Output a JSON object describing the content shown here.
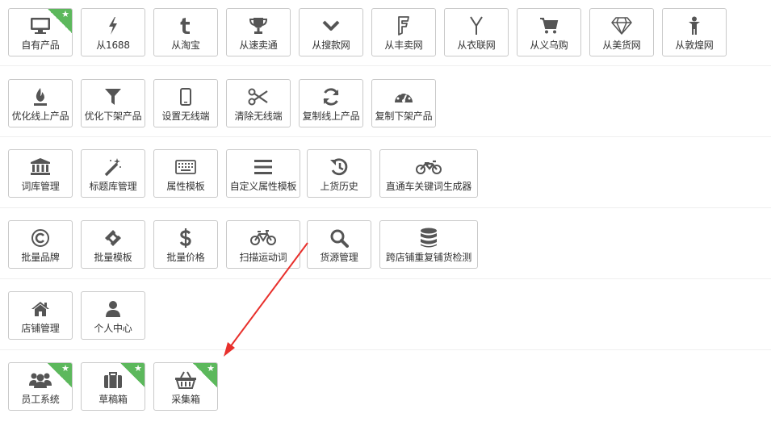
{
  "rows": [
    {
      "items": [
        {
          "label": "自有产品",
          "icon": "monitor-icon",
          "starred": true
        },
        {
          "label": "从1688",
          "icon": "lightning-icon",
          "starred": false
        },
        {
          "label": "从淘宝",
          "icon": "tumblr-t-icon",
          "starred": false
        },
        {
          "label": "从速卖通",
          "icon": "trophy-icon",
          "starred": false
        },
        {
          "label": "从搜款网",
          "icon": "chevron-down-icon",
          "starred": false
        },
        {
          "label": "从丰卖网",
          "icon": "foursquare-icon",
          "starred": false
        },
        {
          "label": "从衣联网",
          "icon": "y-letter-icon",
          "starred": false
        },
        {
          "label": "从义乌购",
          "icon": "shopping-cart-icon",
          "starred": false
        },
        {
          "label": "从美货网",
          "icon": "diamond-icon",
          "starred": false
        },
        {
          "label": "从敦煌网",
          "icon": "child-icon",
          "starred": false
        }
      ]
    },
    {
      "items": [
        {
          "label": "优化线上产品",
          "icon": "fire-icon"
        },
        {
          "label": "优化下架产品",
          "icon": "filter-icon"
        },
        {
          "label": "设置无线端",
          "icon": "mobile-icon"
        },
        {
          "label": "清除无线端",
          "icon": "scissors-icon"
        },
        {
          "label": "复制线上产品",
          "icon": "refresh-icon"
        },
        {
          "label": "复制下架产品",
          "icon": "dashboard-icon"
        }
      ]
    },
    {
      "items": [
        {
          "label": "词库管理",
          "icon": "bank-icon"
        },
        {
          "label": "标题库管理",
          "icon": "magic-wand-icon"
        },
        {
          "label": "属性模板",
          "icon": "keyboard-icon"
        },
        {
          "label": "自定义属性模板",
          "icon": "list-icon"
        },
        {
          "label": "上货历史",
          "icon": "history-icon"
        },
        {
          "label": "直通车关键词生成器",
          "icon": "motorcycle-icon"
        }
      ]
    },
    {
      "items": [
        {
          "label": "批量品牌",
          "icon": "copyright-icon"
        },
        {
          "label": "批量模板",
          "icon": "ticket-icon"
        },
        {
          "label": "批量价格",
          "icon": "dollar-icon"
        },
        {
          "label": "扫描运动词",
          "icon": "bicycle-icon"
        },
        {
          "label": "货源管理",
          "icon": "search-icon"
        },
        {
          "label": "跨店铺重复铺货检测",
          "icon": "database-icon"
        }
      ]
    },
    {
      "items": [
        {
          "label": "店铺管理",
          "icon": "home-icon"
        },
        {
          "label": "个人中心",
          "icon": "user-icon"
        }
      ]
    },
    {
      "items": [
        {
          "label": "员工系统",
          "icon": "users-icon",
          "starred": true
        },
        {
          "label": "草稿箱",
          "icon": "briefcase-icon",
          "starred": true
        },
        {
          "label": "采集箱",
          "icon": "basket-icon",
          "starred": true
        }
      ]
    }
  ],
  "colors": {
    "icon": "#555555",
    "accent_green": "#5cb85c",
    "arrow": "#e8302c"
  }
}
